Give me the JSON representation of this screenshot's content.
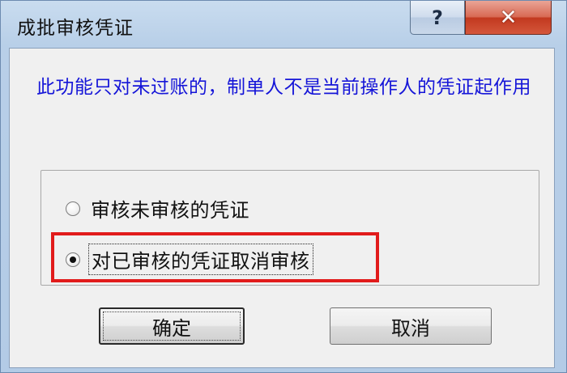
{
  "window": {
    "title": "成批审核凭证"
  },
  "caption_buttons": {
    "help": "?",
    "close": "✕"
  },
  "dialog": {
    "note": "此功能只对未过账的，制单人不是当前操作人的凭证起作用",
    "options": [
      {
        "label": "审核未审核的凭证",
        "selected": false
      },
      {
        "label": "对已审核的凭证取消审核",
        "selected": true
      }
    ],
    "ok_label": "确定",
    "cancel_label": "取消"
  },
  "colors": {
    "note_text": "#1515d8",
    "highlight": "#e11b1b",
    "close_button": "#c2391f"
  }
}
